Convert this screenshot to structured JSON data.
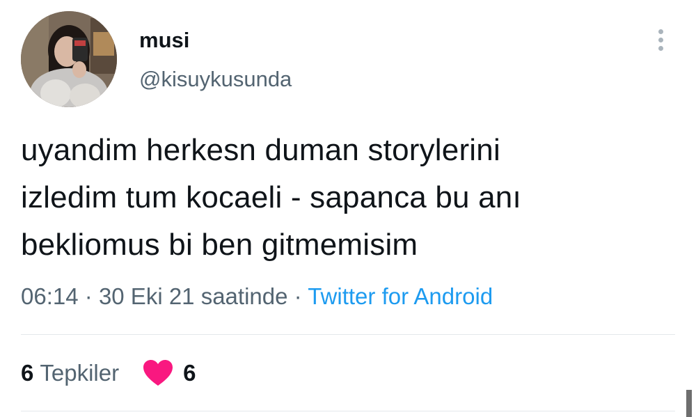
{
  "user": {
    "display_name": "musi",
    "handle": "@kisuykusunda",
    "avatar_icon": "profile-photo"
  },
  "tweet": {
    "text_lines": [
      "uyandim herkesn duman storylerini",
      "izledim tum kocaeli - sapanca bu anı",
      "bekliomus bi ben gitmemisim"
    ],
    "time": "06:14",
    "separator": "·",
    "date": "30 Eki 21 saatinde",
    "source": "Twitter for Android"
  },
  "engagement": {
    "reaction_count": "6",
    "reaction_label": "Tepkiler",
    "heart_icon": "heart-icon",
    "heart_color": "#f91880",
    "heart_count": "6"
  },
  "menu": {
    "icon": "more-vertical-icon"
  },
  "colors": {
    "primary_text": "#0f1419",
    "secondary_text": "#536471",
    "link": "#1d9bf0"
  }
}
